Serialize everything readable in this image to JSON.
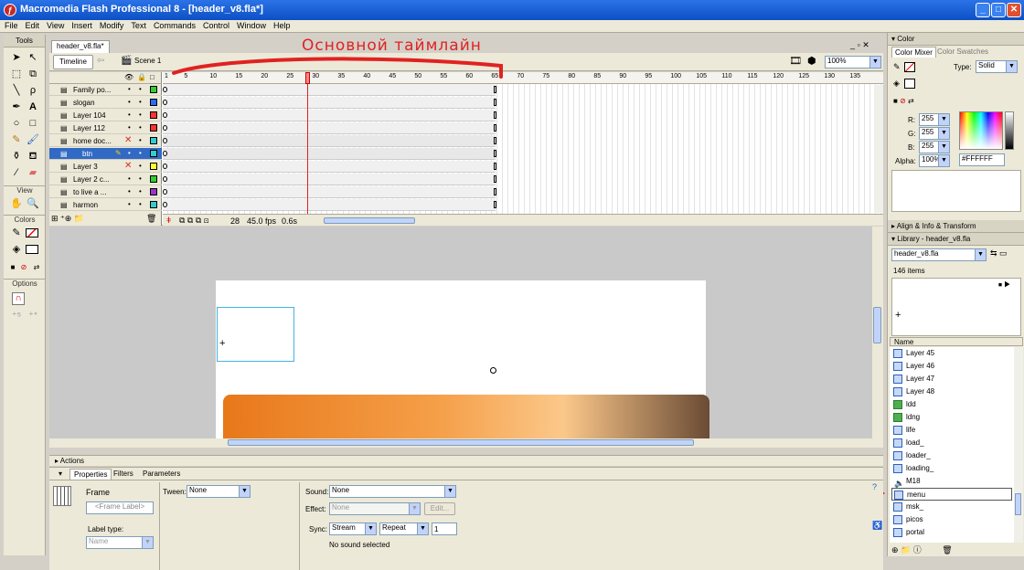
{
  "window": {
    "title": "Macromedia Flash Professional 8 - [header_v8.fla*]"
  },
  "menu": [
    "File",
    "Edit",
    "View",
    "Insert",
    "Modify",
    "Text",
    "Commands",
    "Control",
    "Window",
    "Help"
  ],
  "tools": {
    "header": "Tools",
    "view": "View",
    "colors": "Colors",
    "options": "Options"
  },
  "doc": {
    "tab": "header_v8.fla*",
    "timeline_btn": "Timeline",
    "scene": "Scene 1",
    "zoom": "100%"
  },
  "annotation": {
    "timeline_text": "Основной таймлайн"
  },
  "frame_ruler": [
    "1",
    "5",
    "10",
    "15",
    "20",
    "25",
    "30",
    "35",
    "40",
    "45",
    "50",
    "55",
    "60",
    "65",
    "70",
    "75",
    "80",
    "85",
    "90",
    "95",
    "100",
    "105",
    "110",
    "115",
    "120",
    "125",
    "130",
    "135"
  ],
  "layers": [
    {
      "name": "Family po...",
      "color": "#33cc33",
      "x": false,
      "sel": false
    },
    {
      "name": "slogan",
      "color": "#3366ff",
      "x": false,
      "sel": false
    },
    {
      "name": "Layer 104",
      "color": "#ff3333",
      "x": false,
      "sel": false
    },
    {
      "name": "Layer 112",
      "color": "#ff3333",
      "x": false,
      "sel": false
    },
    {
      "name": "home doc...",
      "color": "#33cccc",
      "x": true,
      "sel": false
    },
    {
      "name": "btn",
      "color": "#33cccc",
      "x": false,
      "sel": true
    },
    {
      "name": "Layer 3",
      "color": "#ffff33",
      "x": true,
      "sel": false
    },
    {
      "name": "Layer 2 c...",
      "color": "#33cc33",
      "x": false,
      "sel": false
    },
    {
      "name": "to live a ...",
      "color": "#9933cc",
      "x": false,
      "sel": false
    },
    {
      "name": "harmon",
      "color": "#33cccc",
      "x": false,
      "sel": false
    }
  ],
  "timeline_status": {
    "frame": "28",
    "fps": "45.0 fps",
    "time": "0.6s"
  },
  "actions_label": "Actions",
  "props": {
    "tabs": [
      "Properties",
      "Filters",
      "Parameters"
    ],
    "frame_label": "Frame",
    "frame_placeholder": "<Frame Label>",
    "label_type": "Label type:",
    "label_type_value": "Name",
    "tween_label": "Tween:",
    "tween_value": "None",
    "sound_label": "Sound:",
    "sound_value": "None",
    "effect_label": "Effect:",
    "effect_value": "None",
    "edit_btn": "Edit...",
    "sync_label": "Sync:",
    "sync_value": "Stream",
    "repeat_value": "Repeat",
    "repeat_count": "1",
    "no_sound": "No sound selected"
  },
  "color_panel": {
    "title": "Color",
    "tabs": [
      "Color Mixer",
      "Color Swatches"
    ],
    "type_label": "Type:",
    "type_value": "Solid",
    "r_label": "R:",
    "r": "255",
    "g_label": "G:",
    "g": "255",
    "b_label": "B:",
    "b": "255",
    "alpha_label": "Alpha:",
    "alpha": "100%",
    "hex": "#FFFFFF"
  },
  "align_panel": "Align & Info & Transform",
  "library": {
    "title": "Library - header_v8.fla",
    "doc": "header_v8.fla",
    "count": "146 items",
    "col_name": "Name",
    "items": [
      {
        "name": "Layer 45",
        "icon": "symbol-icon"
      },
      {
        "name": "Layer 46",
        "icon": "symbol-icon"
      },
      {
        "name": "Layer 47",
        "icon": "symbol-icon"
      },
      {
        "name": "Layer 48",
        "icon": "symbol-icon"
      },
      {
        "name": "ldd",
        "icon": "bitmap-icon"
      },
      {
        "name": "ldng",
        "icon": "bitmap-icon"
      },
      {
        "name": "life",
        "icon": "symbol-icon"
      },
      {
        "name": "load_",
        "icon": "symbol-icon"
      },
      {
        "name": "loader_",
        "icon": "symbol-icon"
      },
      {
        "name": "loading_",
        "icon": "symbol-icon"
      },
      {
        "name": "M18",
        "icon": "sound-icon"
      },
      {
        "name": "menu",
        "icon": "symbol-icon"
      },
      {
        "name": "msk_",
        "icon": "symbol-icon"
      },
      {
        "name": "picos",
        "icon": "symbol-icon"
      },
      {
        "name": "portal",
        "icon": "symbol-icon"
      }
    ]
  }
}
